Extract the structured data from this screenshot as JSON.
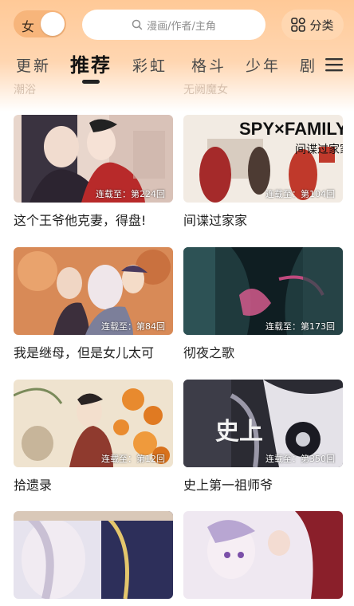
{
  "header": {
    "gender_toggle_label": "女",
    "search_placeholder": "漫画/作者/主角",
    "category_label": "分类"
  },
  "tabs": [
    {
      "label": "更新"
    },
    {
      "label": "推荐"
    },
    {
      "label": "彩虹"
    },
    {
      "label": "格斗"
    },
    {
      "label": "少年"
    },
    {
      "label": "剧"
    }
  ],
  "active_tab": "推荐",
  "faded_titles": [
    "潮浴",
    "无阙魔女"
  ],
  "comics": [
    {
      "title": "这个王爷他克妻，得盘!",
      "status": "连载至：第224回"
    },
    {
      "title": "间谍过家家",
      "status": "连载至：第104回",
      "cover_text": "SPY×FAMILY",
      "cover_subtext": "间谍过家家"
    },
    {
      "title": "我是继母，但是女儿太可",
      "status": "连载至：第84回"
    },
    {
      "title": "彻夜之歌",
      "status": "连载至：第173回"
    },
    {
      "title": "拾遗录",
      "status": "连载至：第12回"
    },
    {
      "title": "史上第一祖师爷",
      "status": "连载至：第350回",
      "cover_text": "史上"
    },
    {
      "title": "",
      "status": ""
    },
    {
      "title": "",
      "status": ""
    }
  ],
  "colors": {
    "header_top": "#ffc997",
    "accent": "#f7b57b",
    "category_bg": "#ffd7b1"
  }
}
